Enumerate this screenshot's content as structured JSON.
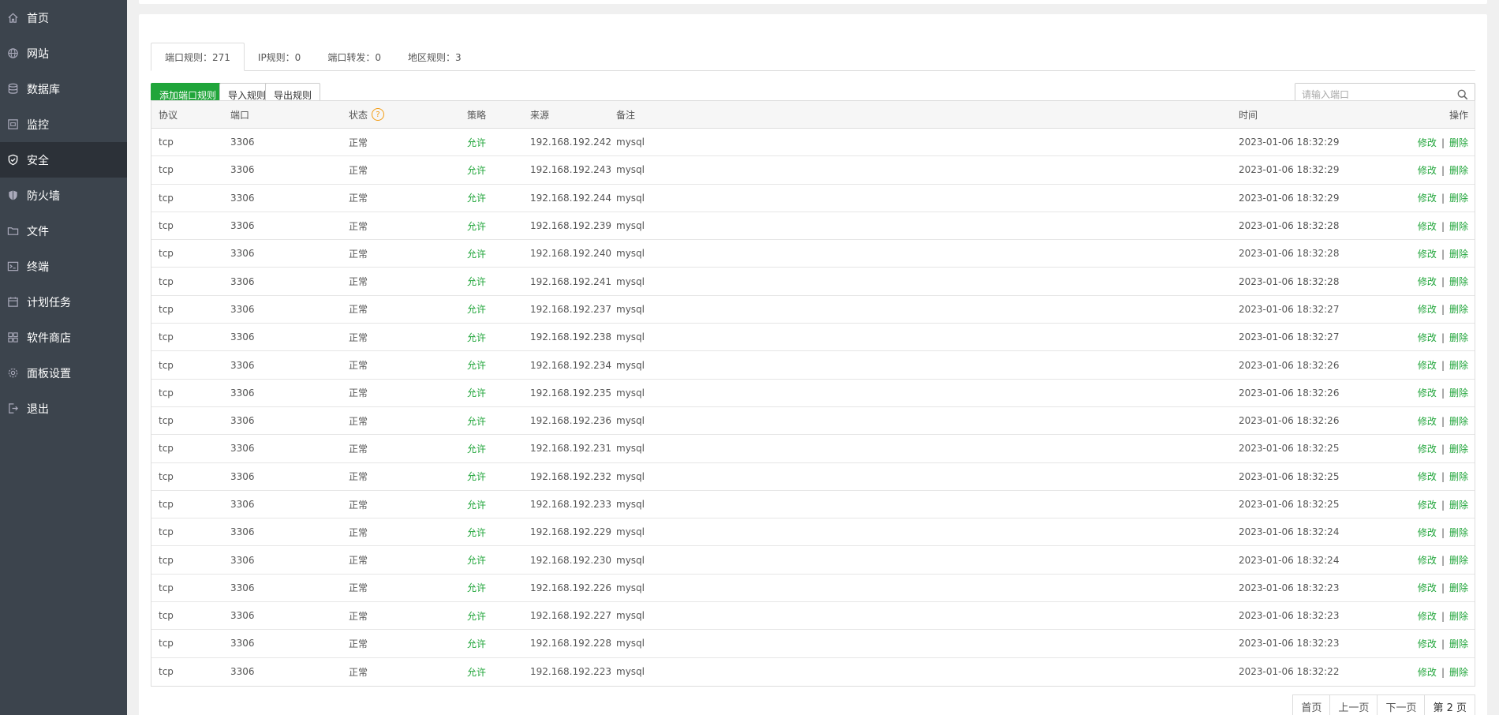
{
  "sidebar": {
    "items": [
      {
        "label": "首页",
        "icon": "home-icon"
      },
      {
        "label": "网站",
        "icon": "globe-icon"
      },
      {
        "label": "数据库",
        "icon": "database-icon"
      },
      {
        "label": "监控",
        "icon": "monitor-icon"
      },
      {
        "label": "安全",
        "icon": "shield-icon",
        "active": true
      },
      {
        "label": "防火墙",
        "icon": "firewall-icon"
      },
      {
        "label": "文件",
        "icon": "folder-icon"
      },
      {
        "label": "终端",
        "icon": "terminal-icon"
      },
      {
        "label": "计划任务",
        "icon": "calendar-icon"
      },
      {
        "label": "软件商店",
        "icon": "apps-icon"
      },
      {
        "label": "面板设置",
        "icon": "gear-icon"
      },
      {
        "label": "退出",
        "icon": "logout-icon"
      }
    ]
  },
  "tabs": [
    {
      "label": "端口规则：271",
      "active": true
    },
    {
      "label": "IP规则：0"
    },
    {
      "label": "端口转发：0"
    },
    {
      "label": "地区规则：3"
    }
  ],
  "toolbar": {
    "add_label": "添加端口规则",
    "import_label": "导入规则",
    "export_label": "导出规则"
  },
  "search": {
    "placeholder": "请输入端口"
  },
  "table": {
    "headers": {
      "protocol": "协议",
      "port": "端口",
      "status": "状态",
      "policy": "策略",
      "source": "来源",
      "note": "备注",
      "time": "时间",
      "action": "操作"
    },
    "rows": [
      {
        "protocol": "tcp",
        "port": "3306",
        "status": "正常",
        "policy": "允许",
        "source": "192.168.192.242",
        "note": "mysql",
        "time": "2023-01-06 18:32:29"
      },
      {
        "protocol": "tcp",
        "port": "3306",
        "status": "正常",
        "policy": "允许",
        "source": "192.168.192.243",
        "note": "mysql",
        "time": "2023-01-06 18:32:29"
      },
      {
        "protocol": "tcp",
        "port": "3306",
        "status": "正常",
        "policy": "允许",
        "source": "192.168.192.244",
        "note": "mysql",
        "time": "2023-01-06 18:32:29"
      },
      {
        "protocol": "tcp",
        "port": "3306",
        "status": "正常",
        "policy": "允许",
        "source": "192.168.192.239",
        "note": "mysql",
        "time": "2023-01-06 18:32:28"
      },
      {
        "protocol": "tcp",
        "port": "3306",
        "status": "正常",
        "policy": "允许",
        "source": "192.168.192.240",
        "note": "mysql",
        "time": "2023-01-06 18:32:28"
      },
      {
        "protocol": "tcp",
        "port": "3306",
        "status": "正常",
        "policy": "允许",
        "source": "192.168.192.241",
        "note": "mysql",
        "time": "2023-01-06 18:32:28"
      },
      {
        "protocol": "tcp",
        "port": "3306",
        "status": "正常",
        "policy": "允许",
        "source": "192.168.192.237",
        "note": "mysql",
        "time": "2023-01-06 18:32:27"
      },
      {
        "protocol": "tcp",
        "port": "3306",
        "status": "正常",
        "policy": "允许",
        "source": "192.168.192.238",
        "note": "mysql",
        "time": "2023-01-06 18:32:27"
      },
      {
        "protocol": "tcp",
        "port": "3306",
        "status": "正常",
        "policy": "允许",
        "source": "192.168.192.234",
        "note": "mysql",
        "time": "2023-01-06 18:32:26"
      },
      {
        "protocol": "tcp",
        "port": "3306",
        "status": "正常",
        "policy": "允许",
        "source": "192.168.192.235",
        "note": "mysql",
        "time": "2023-01-06 18:32:26"
      },
      {
        "protocol": "tcp",
        "port": "3306",
        "status": "正常",
        "policy": "允许",
        "source": "192.168.192.236",
        "note": "mysql",
        "time": "2023-01-06 18:32:26"
      },
      {
        "protocol": "tcp",
        "port": "3306",
        "status": "正常",
        "policy": "允许",
        "source": "192.168.192.231",
        "note": "mysql",
        "time": "2023-01-06 18:32:25"
      },
      {
        "protocol": "tcp",
        "port": "3306",
        "status": "正常",
        "policy": "允许",
        "source": "192.168.192.232",
        "note": "mysql",
        "time": "2023-01-06 18:32:25"
      },
      {
        "protocol": "tcp",
        "port": "3306",
        "status": "正常",
        "policy": "允许",
        "source": "192.168.192.233",
        "note": "mysql",
        "time": "2023-01-06 18:32:25"
      },
      {
        "protocol": "tcp",
        "port": "3306",
        "status": "正常",
        "policy": "允许",
        "source": "192.168.192.229",
        "note": "mysql",
        "time": "2023-01-06 18:32:24"
      },
      {
        "protocol": "tcp",
        "port": "3306",
        "status": "正常",
        "policy": "允许",
        "source": "192.168.192.230",
        "note": "mysql",
        "time": "2023-01-06 18:32:24"
      },
      {
        "protocol": "tcp",
        "port": "3306",
        "status": "正常",
        "policy": "允许",
        "source": "192.168.192.226",
        "note": "mysql",
        "time": "2023-01-06 18:32:23"
      },
      {
        "protocol": "tcp",
        "port": "3306",
        "status": "正常",
        "policy": "允许",
        "source": "192.168.192.227",
        "note": "mysql",
        "time": "2023-01-06 18:32:23"
      },
      {
        "protocol": "tcp",
        "port": "3306",
        "status": "正常",
        "policy": "允许",
        "source": "192.168.192.228",
        "note": "mysql",
        "time": "2023-01-06 18:32:23"
      },
      {
        "protocol": "tcp",
        "port": "3306",
        "status": "正常",
        "policy": "允许",
        "source": "192.168.192.223",
        "note": "mysql",
        "time": "2023-01-06 18:32:22"
      }
    ],
    "edit_label": "修改",
    "delete_label": "删除",
    "sep": "|"
  },
  "pagination": {
    "first": "首页",
    "prev": "上一页",
    "next": "下一页",
    "current": "第 2 页"
  },
  "colors": {
    "sidebar_bg": "#3c444d",
    "sidebar_active": "#2c3138",
    "accent": "#20a53a",
    "help_icon": "#f39c12"
  }
}
